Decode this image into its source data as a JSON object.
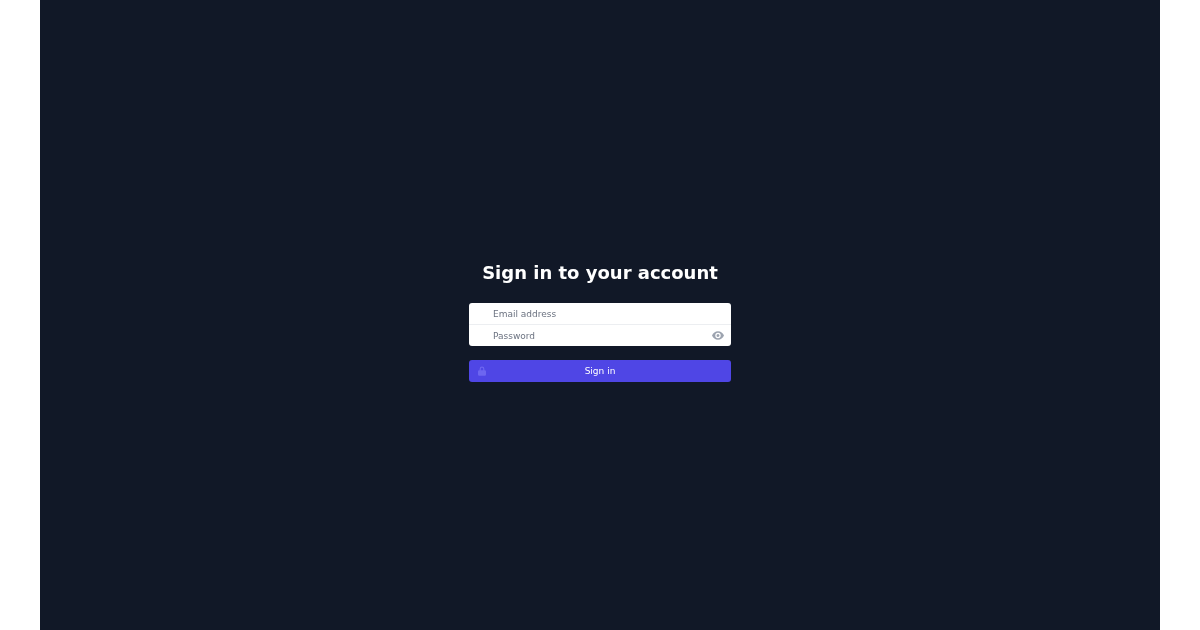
{
  "heading": "Sign in to your account",
  "fields": [
    {
      "kind": "email",
      "placeholder": "Email address"
    },
    {
      "kind": "password",
      "placeholder": "Password"
    }
  ],
  "submit": {
    "label": "Sign in"
  }
}
